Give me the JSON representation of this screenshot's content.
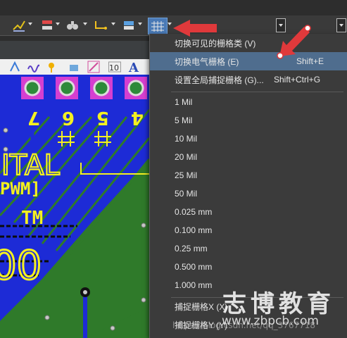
{
  "menu": {
    "items": [
      {
        "label": "切换可见的栅格类 (V)",
        "shortcut": ""
      },
      {
        "label": "切换电气栅格 (E)",
        "shortcut": "Shift+E"
      },
      {
        "label": "设置全局捕捉栅格 (G)...",
        "shortcut": "Shift+Ctrl+G"
      },
      {
        "label": "1 Mil",
        "shortcut": ""
      },
      {
        "label": "5 Mil",
        "shortcut": ""
      },
      {
        "label": "10 Mil",
        "shortcut": ""
      },
      {
        "label": "20 Mil",
        "shortcut": ""
      },
      {
        "label": "25 Mil",
        "shortcut": ""
      },
      {
        "label": "50 Mil",
        "shortcut": ""
      },
      {
        "label": "0.025 mm",
        "shortcut": ""
      },
      {
        "label": "0.100 mm",
        "shortcut": ""
      },
      {
        "label": "0.25 mm",
        "shortcut": ""
      },
      {
        "label": "0.500 mm",
        "shortcut": ""
      },
      {
        "label": "1.000 mm",
        "shortcut": ""
      },
      {
        "label": "捕捉栅格X (X)",
        "shortcut": ""
      },
      {
        "label": "捕捉栅格Y (Y)",
        "shortcut": ""
      }
    ]
  },
  "pcb": {
    "pad_labels": [
      "7",
      "6",
      "5",
      "4"
    ],
    "silk_text": [
      "ITAL",
      "PWM]",
      "TM",
      "00"
    ]
  },
  "watermark": {
    "title": "志博教育",
    "url": "www.zbpcb.com",
    "csdn": "https://blog.csdn.net/qq_3767718"
  },
  "colors": {
    "menu_bg": "#3b3b3b",
    "menu_highlight": "#4f6d8e",
    "pcb_green": "#2f7a2a",
    "trace_blue": "#1d2bd6",
    "silk_yellow": "#f5f020",
    "arrow_red": "#e0393b"
  }
}
